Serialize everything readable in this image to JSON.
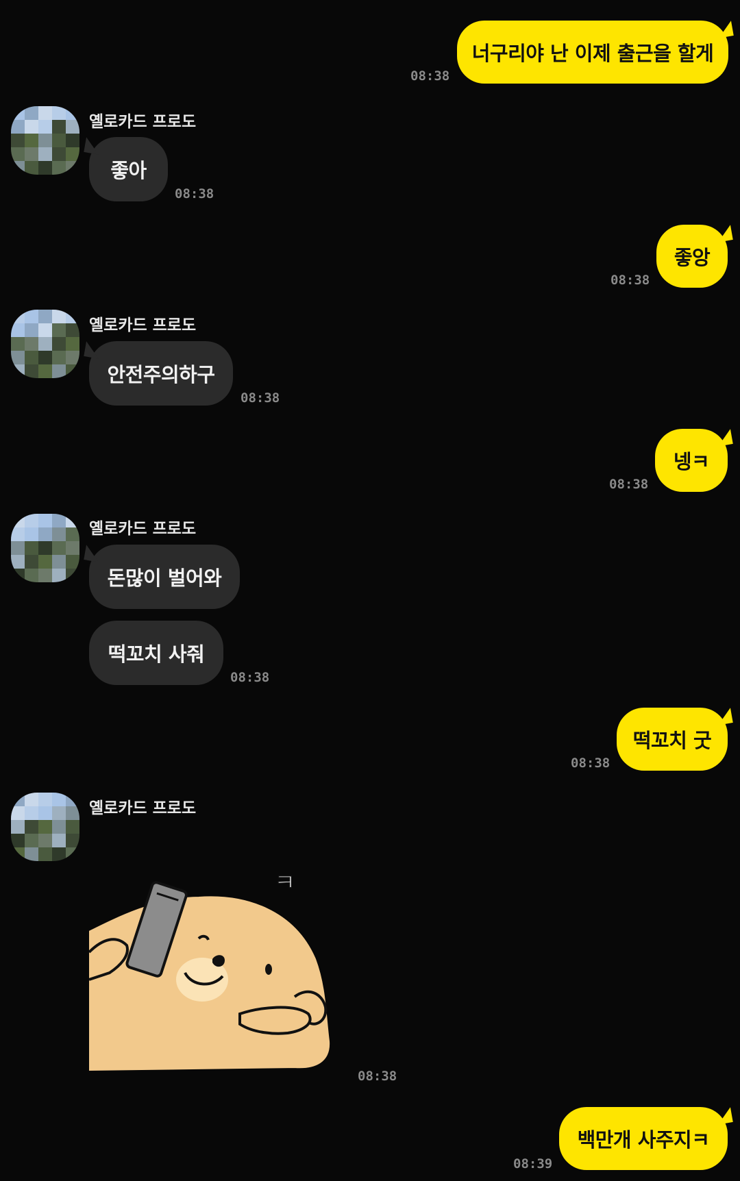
{
  "contact": {
    "name": "옐로카드 프로도"
  },
  "messages": [
    {
      "from": "me",
      "text": "너구리야 난 이제 출근을 할게",
      "time": "08:38"
    },
    {
      "from": "them",
      "text": "좋아",
      "time": "08:38"
    },
    {
      "from": "me",
      "text": "좋앙",
      "time": "08:38"
    },
    {
      "from": "them",
      "text": "안전주의하구",
      "time": "08:38"
    },
    {
      "from": "me",
      "text": "넹ㅋ",
      "time": "08:38"
    },
    {
      "from": "them",
      "text": "돈많이 벌어와",
      "time": ""
    },
    {
      "from": "them",
      "text": "떡꼬치 사줘",
      "time": "08:38"
    },
    {
      "from": "me",
      "text": "떡꼬치 굿",
      "time": "08:38"
    },
    {
      "from": "them",
      "type": "sticker",
      "sticker_text": "ㅋ",
      "time": "08:38"
    },
    {
      "from": "me",
      "text": "백만개 사주지ㅋ",
      "time": "08:39"
    }
  ],
  "colors": {
    "me_bubble": "#fee500",
    "them_bubble": "#2b2b2b",
    "background": "#080808"
  }
}
